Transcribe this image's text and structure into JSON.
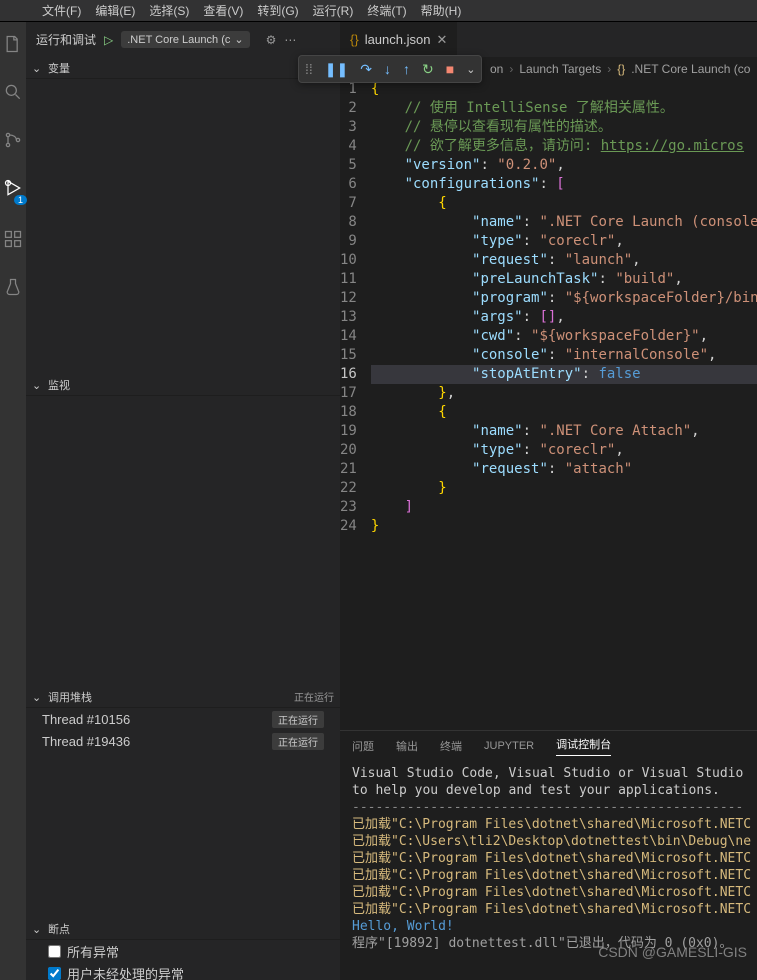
{
  "menubar": [
    "文件(F)",
    "编辑(E)",
    "选择(S)",
    "查看(V)",
    "转到(G)",
    "运行(R)",
    "终端(T)",
    "帮助(H)"
  ],
  "sidetop": {
    "label": "运行和调试",
    "config": ".NET Core Launch (c"
  },
  "sections": {
    "variables": "变量",
    "watch": "监视",
    "callstack": "调用堆栈",
    "callstack_status": "正在运行",
    "breakpoints": "断点"
  },
  "threads": [
    {
      "name": "Thread #10156",
      "status": "正在运行"
    },
    {
      "name": "Thread #19436",
      "status": "正在运行"
    }
  ],
  "bps": [
    {
      "label": "所有异常",
      "checked": false
    },
    {
      "label": "用户未经处理的异常",
      "checked": true
    }
  ],
  "tab": {
    "name": "launch.json"
  },
  "breadcrumb": {
    "mid": "Launch Targets",
    "last": ".NET Core Launch (co"
  },
  "code": {
    "c1": "// 使用 IntelliSense 了解相关属性。",
    "c2": "// 悬停以查看现有属性的描述。",
    "c3": "// 欲了解更多信息，请访问: ",
    "c3link": "https://go.micros",
    "version_k": "\"version\"",
    "version_v": "\"0.2.0\"",
    "config_k": "\"configurations\"",
    "name_k": "\"name\"",
    "name_v": "\".NET Core Launch (console",
    "type_k": "\"type\"",
    "type_v": "\"coreclr\"",
    "request_k": "\"request\"",
    "request_v": "\"launch\"",
    "prelaunch_k": "\"preLaunchTask\"",
    "prelaunch_v": "\"build\"",
    "program_k": "\"program\"",
    "program_v": "\"${workspaceFolder}/bin",
    "args_k": "\"args\"",
    "cwd_k": "\"cwd\"",
    "cwd_v": "\"${workspaceFolder}\"",
    "console_k": "\"console\"",
    "console_v": "\"internalConsole\"",
    "stop_k": "\"stopAtEntry\"",
    "stop_v": "false",
    "name2_v": "\".NET Core Attach\"",
    "request2_v": "\"attach\""
  },
  "panel_tabs": [
    "问题",
    "输出",
    "终端",
    "JUPYTER",
    "调试控制台"
  ],
  "panel_active": 4,
  "console": {
    "l1": "Visual Studio Code, Visual Studio or Visual Studio",
    "l2": "to help you develop and test your applications.",
    "dash": "--------------------------------------------------",
    "l3": "已加载\"C:\\Program Files\\dotnet\\shared\\Microsoft.NETC",
    "l4": "已加载\"C:\\Users\\tli2\\Desktop\\dotnettest\\bin\\Debug\\ne",
    "l5": "已加载\"C:\\Program Files\\dotnet\\shared\\Microsoft.NETC",
    "l6": "已加载\"C:\\Program Files\\dotnet\\shared\\Microsoft.NETC",
    "l7": "已加载\"C:\\Program Files\\dotnet\\shared\\Microsoft.NETC",
    "l8": "已加载\"C:\\Program Files\\dotnet\\shared\\Microsoft.NETC",
    "hello": "Hello, World!",
    "exit": "程序\"[19892] dotnettest.dll\"已退出，代码为 0 (0x0)。"
  },
  "watermark": "CSDN @GAMESLI-GIS"
}
